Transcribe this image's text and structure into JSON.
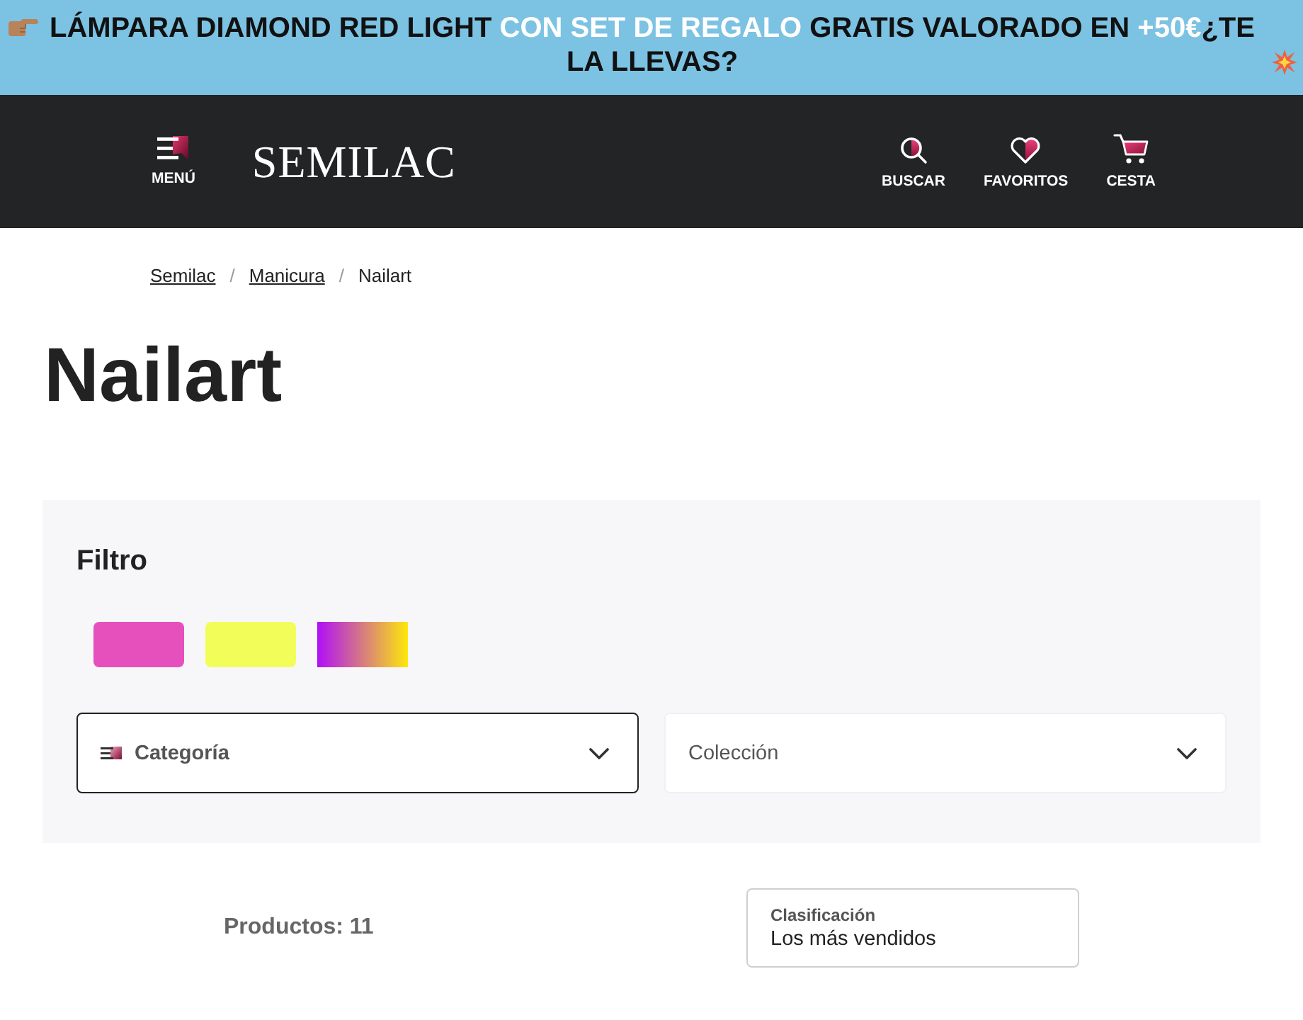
{
  "promo_banner": {
    "segments": [
      {
        "text": "LÁMPARA DIAMOND RED LIGHT ",
        "highlight": false
      },
      {
        "text": "CON SET DE REGALO",
        "highlight": true
      },
      {
        "text": " GRATIS VALORADO EN ",
        "highlight": false
      },
      {
        "text": "+50€",
        "highlight": true
      },
      {
        "text": "¿TE LA LLEVAS?",
        "highlight": false
      }
    ]
  },
  "header": {
    "menu": {
      "label": "MENÚ"
    },
    "logo": "SEMILAC",
    "actions": [
      {
        "kind": "search",
        "label": "BUSCAR"
      },
      {
        "kind": "favorites",
        "label": "FAVORITOS"
      },
      {
        "kind": "cart",
        "label": "CESTA"
      }
    ]
  },
  "breadcrumb": {
    "items": [
      {
        "label": "Semilac",
        "current": false
      },
      {
        "label": "Manicura",
        "current": false
      },
      {
        "label": "Nailart",
        "current": true
      }
    ],
    "separators": [
      "/",
      "/"
    ]
  },
  "page_title": "Nailart",
  "filter": {
    "title": "Filtro",
    "swatches": [
      {
        "kind": "solid",
        "color": "#e650bc"
      },
      {
        "kind": "solid",
        "color": "#f3fd5a"
      },
      {
        "kind": "gradient",
        "stops": [
          {
            "color": "#b00ff8"
          },
          {
            "color": "#fde80a"
          }
        ]
      }
    ],
    "dropdowns": [
      {
        "label": "Categoría",
        "selected": true
      },
      {
        "label": "Colección",
        "selected": false
      }
    ]
  },
  "results": {
    "count": "Productos: 11",
    "sort": {
      "label": "Clasificación",
      "value": "Los más vendidos"
    }
  }
}
